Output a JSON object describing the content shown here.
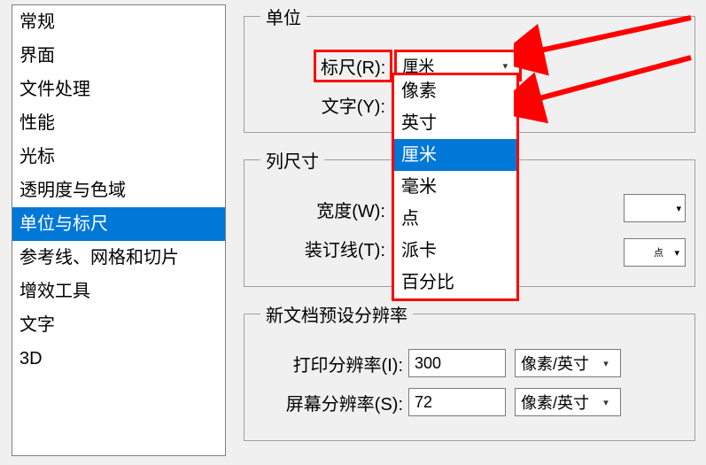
{
  "sidebar": {
    "items": [
      {
        "label": "常规"
      },
      {
        "label": "界面"
      },
      {
        "label": "文件处理"
      },
      {
        "label": "性能"
      },
      {
        "label": "光标"
      },
      {
        "label": "透明度与色域"
      },
      {
        "label": "单位与标尺",
        "selected": true
      },
      {
        "label": "参考线、网格和切片"
      },
      {
        "label": "增效工具"
      },
      {
        "label": "文字"
      },
      {
        "label": "3D"
      }
    ]
  },
  "units": {
    "legend": "单位",
    "ruler_label": "标尺(R):",
    "text_label": "文字(Y):",
    "ruler_value": "厘米",
    "dropdown_options": [
      "像素",
      "英寸",
      "厘米",
      "毫米",
      "点",
      "派卡",
      "百分比"
    ],
    "dropdown_selected_index": 2
  },
  "col_size": {
    "legend": "列尺寸",
    "width_label": "宽度(W):",
    "gutter_label": "装订线(T):",
    "gutter_unit": "点"
  },
  "new_doc": {
    "legend": "新文档预设分辨率",
    "print_label": "打印分辨率(I):",
    "print_value": "300",
    "screen_label": "屏幕分辨率(S):",
    "screen_value": "72",
    "unit": "像素/英寸"
  }
}
